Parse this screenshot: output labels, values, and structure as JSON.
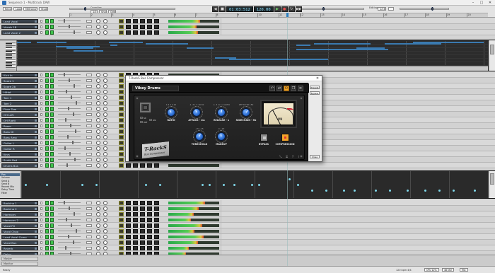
{
  "window": {
    "title": "Sequence 1 - Multitrack DAW"
  },
  "toolbar": {
    "menu_buttons": [
      "Record",
      "Loop",
      "Metronome",
      "Studio"
    ],
    "group_label": "Quantize",
    "edit_buttons": [
      "1/16",
      "Snap",
      "Grid"
    ],
    "position": "01:03:512",
    "tempo": "120.00",
    "right_label": "Editing",
    "right_value": "1/16",
    "ruler_numbers": [
      "1",
      "2",
      "3",
      "4",
      "5",
      "6",
      "7",
      "8",
      "9",
      "10",
      "11",
      "12",
      "13",
      "14",
      "15",
      "16",
      "17",
      "18",
      "19",
      "20"
    ]
  },
  "tracks_top": [
    {
      "name": "Lead Vocal",
      "meter": 0.62
    },
    {
      "name": "Vocals 1B",
      "meter": 0.55
    },
    {
      "name": "Lead Vocal 2",
      "meter": 0.58
    }
  ],
  "tracks_mid": [
    {
      "name": "Kick In",
      "meter": 0
    },
    {
      "name": "Snare 1",
      "meter": 0
    },
    {
      "name": "Snare 2b",
      "meter": 0
    },
    {
      "name": "HiHat",
      "meter": 0
    },
    {
      "name": "Tom 1",
      "meter": 0
    },
    {
      "name": "Tom 2",
      "meter": 0
    },
    {
      "name": "Floor Tom",
      "meter": 0
    },
    {
      "name": "OH Left",
      "meter": 0
    },
    {
      "name": "OH Right",
      "meter": 0
    },
    {
      "name": "Room",
      "meter": 0
    },
    {
      "name": "Bass DI",
      "meter": 0
    },
    {
      "name": "Bass Amp",
      "meter": 0
    },
    {
      "name": "Guitar L",
      "meter": 0
    },
    {
      "name": "Guitar R",
      "meter": 0
    },
    {
      "name": "Keys",
      "meter": 0
    },
    {
      "name": "Synth Pad",
      "meter": 0
    },
    {
      "name": "Drums Bus",
      "meter": 0
    }
  ],
  "tracks_bottom": [
    {
      "name": "Backing 1",
      "meter": 0.72
    },
    {
      "name": "Backing 2",
      "meter": 0.6
    },
    {
      "name": "Harmony",
      "meter": 0.5
    },
    {
      "name": "Harmony 2",
      "meter": 0.45
    },
    {
      "name": "Vocal FX",
      "meter": 0.66
    },
    {
      "name": "Vocal Chop",
      "meter": 0.52
    },
    {
      "name": "Lead Vocal Comp",
      "meter": 0.7
    },
    {
      "name": "Vocal Bus",
      "meter": 0.58
    },
    {
      "name": "Reverb",
      "meter": 0.4
    },
    {
      "name": "Delay",
      "meter": 0.35
    }
  ],
  "automation_list": [
    "Pan",
    "Volume",
    "Send A",
    "Send B",
    "Reverb Mix",
    "Delay Time",
    "Filter"
  ],
  "master": {
    "row1": "Master",
    "row2": "Monitor"
  },
  "plugin": {
    "window_title": "T-RackS Bus Compressor",
    "preset": "Vibey Drums",
    "side_buttons": [
      "Presets",
      "Bypass",
      "Close"
    ],
    "brand_line1": "T-RackS",
    "brand_line2": "Bus Compressor",
    "mini_labels": [
      "SC",
      "HPF",
      "ON"
    ],
    "knobs": [
      {
        "label": "RATIO",
        "scale": "1.5  2  4  10"
      },
      {
        "label": "ATTACK - ms",
        "scale": ".1  .3  1  3  10  30"
      },
      {
        "label": "RELEASE - s",
        "scale": ".1  .3  .6  1.2  AUTO"
      },
      {
        "label": "SIDECHAIN - Hz",
        "scale": "OFF  60  90  150"
      },
      {
        "label": "THRESHOLD",
        "scale": "-15  +15"
      },
      {
        "label": "MAKEUP",
        "scale": "0  +20"
      }
    ],
    "meter_label": "VU",
    "buttons": [
      "BYPASS",
      "COMPRESSION"
    ]
  },
  "status": {
    "left": "Ready",
    "right_buttons": [
      "CPU 12%",
      "48 kHz",
      "Mix"
    ],
    "right_text": "120 bpm 4/4"
  },
  "colors": {
    "accent": "#2a7fc0",
    "meter_green": "#3cc24a",
    "plugin_knob": "#2d6fd6",
    "plugin_orange": "#f4a52a"
  }
}
